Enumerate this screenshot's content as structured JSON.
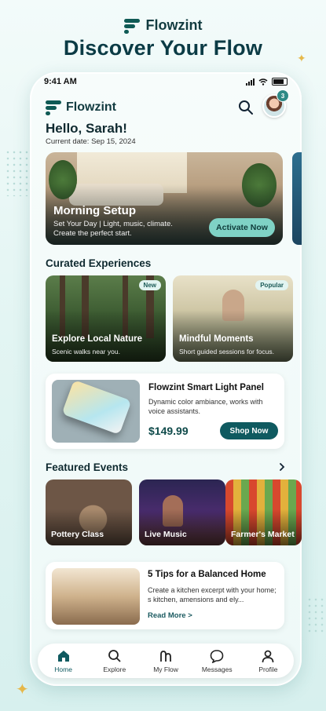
{
  "brand": {
    "name": "Flowzint",
    "headline": "Discover Your Flow"
  },
  "status_bar": {
    "time": "9:41 AM"
  },
  "header": {
    "app_name": "Flowzint",
    "notification_count": "3"
  },
  "greeting": {
    "title": "Hello, Sarah!",
    "date": "Current date: Sep 15, 2024"
  },
  "hero": {
    "title": "Morning Setup",
    "subtitle_line1": "Set Your Day | Light, music, climate.",
    "subtitle_line2": "Create the perfect start.",
    "cta": "Activate Now"
  },
  "curated": {
    "title": "Curated Experiences",
    "cards": [
      {
        "tag": "New",
        "title": "Explore Local Nature",
        "subtitle": "Scenic walks near you."
      },
      {
        "tag": "Popular",
        "title": "Mindful Moments",
        "subtitle": "Short guided sessions for focus."
      }
    ]
  },
  "product": {
    "title": "Flowzint Smart Light Panel",
    "description": "Dynamic color ambiance, works with voice assistants.",
    "price": "$149.99",
    "cta": "Shop Now"
  },
  "events": {
    "title": "Featured Events",
    "items": [
      {
        "label": "Pottery Class"
      },
      {
        "label": "Live Music"
      },
      {
        "label": "Farmer's Market"
      }
    ]
  },
  "article": {
    "title": "5 Tips for a Balanced Home",
    "description": "Create a kitchen excerpt with your home; s kitchen, amensions and ely...",
    "link": "Read More >"
  },
  "tabbar": {
    "tabs": [
      {
        "label": "Home",
        "icon": "home-icon"
      },
      {
        "label": "Explore",
        "icon": "search-icon"
      },
      {
        "label": "My Flow",
        "icon": "flow-icon"
      },
      {
        "label": "Messages",
        "icon": "chat-icon"
      },
      {
        "label": "Profile",
        "icon": "user-icon"
      }
    ]
  },
  "colors": {
    "accent": "#0f5a60",
    "cta_light": "#7fd2c5",
    "background": "#e3f5f3"
  }
}
